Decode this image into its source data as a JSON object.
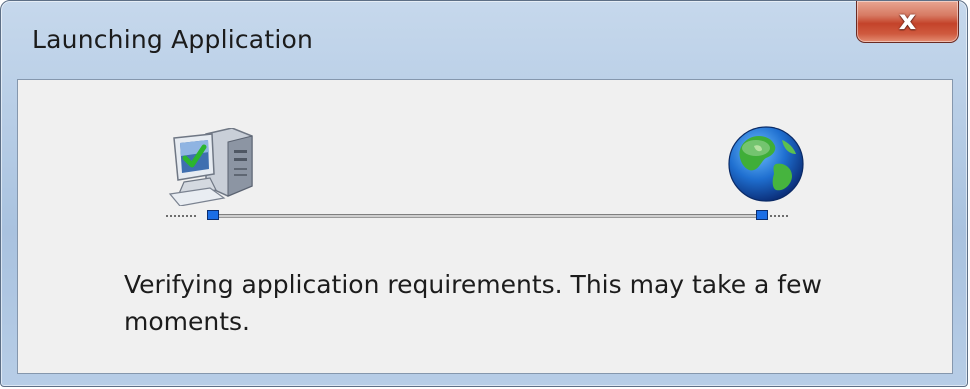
{
  "window": {
    "title": "Launching Application",
    "close_glyph": "x"
  },
  "icons": {
    "computer": "computer-check-icon",
    "internet": "globe-icon"
  },
  "message": "Verifying application requirements. This may take a few moments.",
  "colors": {
    "title_bar": "#b3cae4",
    "close_button": "#c4432a",
    "content_bg": "#f0f0f0",
    "port": "#1b6ee6"
  }
}
